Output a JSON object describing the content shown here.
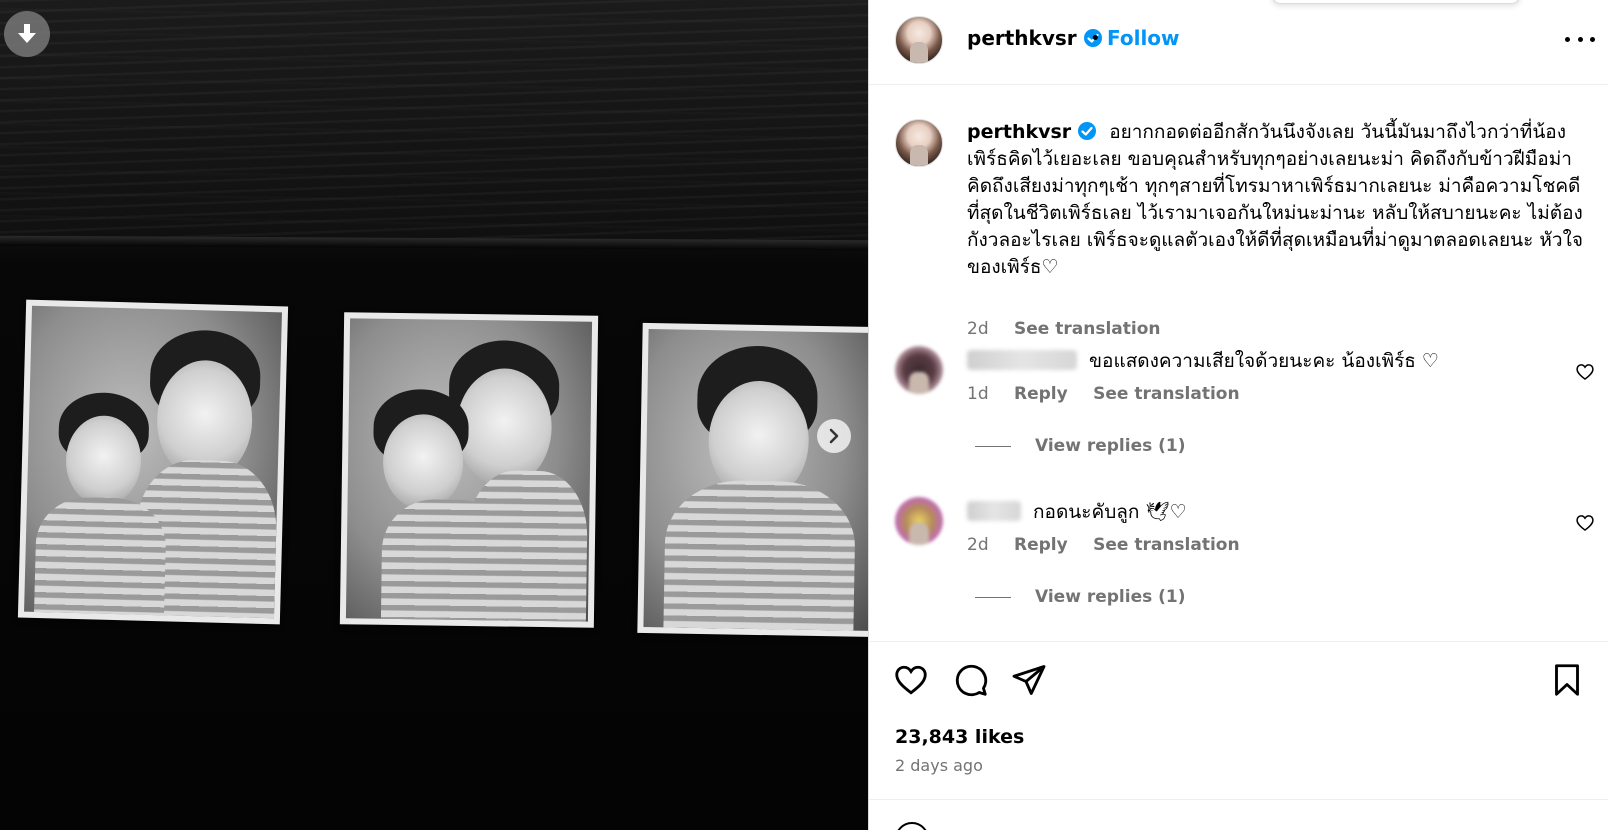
{
  "post": {
    "username": "perthkvsr",
    "follow_label": "Follow",
    "separator": "•"
  },
  "caption": {
    "username": "perthkvsr",
    "text": "อยากกอดต่ออีกสักวันนึงจังเลย วันนี้มันมาถึงไวกว่าที่น้องเพิร์ธคิดไว้เยอะเลย ขอบคุณสำหรับทุกๆอย่างเลยนะม่า คิดถึงกับข้าวฝีมือม่า คิดถึงเสียงม่าทุกๆเช้า ทุกๆสายที่โทรมาหาเพิร์ธมากเลยนะ ม่าคือความโชคดีที่สุดในชีวิตเพิร์ธเลย ไว้เรามาเจอกันใหม่นะม่านะ หลับให้สบายนะคะ ไม่ต้องกังวลอะไรเลย เพิร์ธจะดูแลตัวเองให้ดีที่สุดเหมือนที่ม่าดูมาตลอดเลยนะ หัวใจของเพิร์ธ♡",
    "age": "2d",
    "see_translation": "See translation"
  },
  "comments": [
    {
      "username": "apple_1987",
      "text": "ขอแสดงความเสียใจด้วยนะคะ น้องเพิร์ธ ♡",
      "age": "1d",
      "reply": "Reply",
      "see_translation": "See translation",
      "view_replies": "View replies (1)"
    },
    {
      "username": "ikcha",
      "text": "กอดนะคับลูก 🕊♡",
      "age": "2d",
      "reply": "Reply",
      "see_translation": "See translation",
      "view_replies": "View replies (1)"
    }
  ],
  "stats": {
    "likes": "23,843 likes",
    "posted": "2 days ago"
  },
  "icons": {
    "download": "download-icon",
    "next": "chevron-right-icon",
    "verified": "verified-badge-icon",
    "more": "more-options-icon",
    "like": "heart-icon",
    "comment": "comment-icon",
    "share": "share-icon",
    "save": "bookmark-icon"
  },
  "colors": {
    "accent": "#0095f6",
    "muted": "#737373"
  }
}
